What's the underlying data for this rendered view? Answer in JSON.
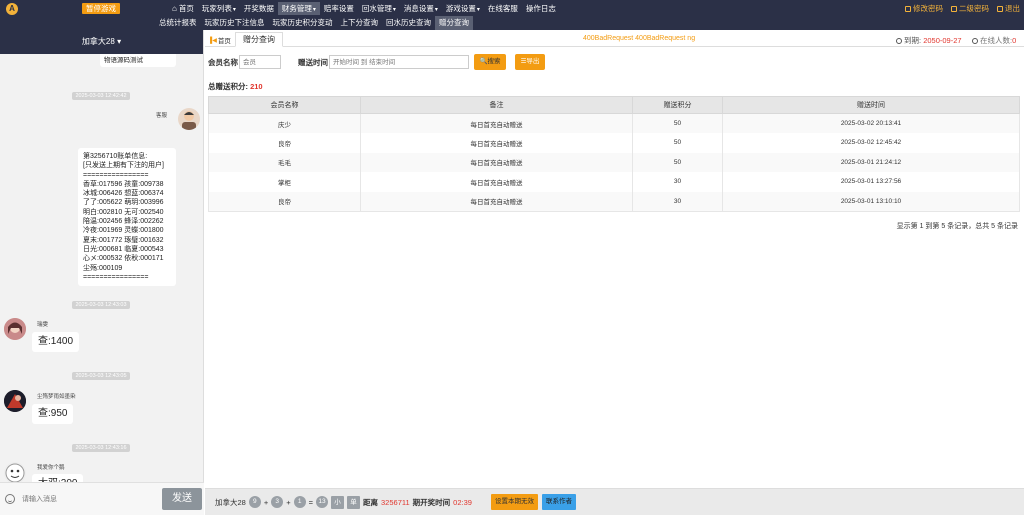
{
  "topbar": {
    "logo": "A",
    "pause_label": "暂停游戏",
    "nav_row1": [
      {
        "label": "首页",
        "home": true
      },
      {
        "label": "玩家列表",
        "dropdown": true
      },
      {
        "label": "开奖数据"
      },
      {
        "label": "财务管理",
        "dropdown": true,
        "active": true
      },
      {
        "label": "赔率设置"
      },
      {
        "label": "回水管理",
        "dropdown": true
      },
      {
        "label": "消息设置",
        "dropdown": true
      },
      {
        "label": "游戏设置",
        "dropdown": true
      },
      {
        "label": "在线客服"
      },
      {
        "label": "操作日志"
      }
    ],
    "nav_row2": [
      {
        "label": "总统计报表"
      },
      {
        "label": "玩家历史下注信息"
      },
      {
        "label": "玩家历史积分变动"
      },
      {
        "label": "上下分查询"
      },
      {
        "label": "回水历史查询"
      },
      {
        "label": "赠分查询",
        "active": true
      }
    ],
    "right_links": [
      "修改密码",
      "二级密码",
      "退出"
    ]
  },
  "chat": {
    "header": "加拿大28",
    "messages": [
      {
        "type": "partial",
        "text": "已开盘可以进行下注\n物语源码测试"
      },
      {
        "type": "time",
        "text": "2025-03-03 12:42:42"
      },
      {
        "type": "bill",
        "sender": "客服",
        "text": "第3256710账单信息:\n[只发送上期有下注的用户]\n================\n香草:017596 孩童:009738\n冰城:006426 想蓝:006374\n了了:005622 萌玥:003996\n明白:002810 无可:002540\n陪温:002456 蜂泽:002262\n冷夜:001969 灵蝶:001800\n夏末:001772 琢璧:001632\n日光:000681 临夏:000543\n心メ:000532 依秋:000171\n尘殇:000109\n================"
      },
      {
        "type": "time",
        "text": "2025-03-03 12:43:03"
      },
      {
        "type": "user",
        "sender": "瑞雯",
        "text": "查:1400"
      },
      {
        "type": "time",
        "text": "2025-03-03 12:43:05"
      },
      {
        "type": "user",
        "sender": "尘殇梦雨如墨染",
        "text": "查:950"
      },
      {
        "type": "time",
        "text": "2025-03-03 12:43:16"
      },
      {
        "type": "user",
        "sender": "我爱你个鹅",
        "text": "大双:200"
      }
    ],
    "input_placeholder": "请输入消息",
    "send_label": "发送"
  },
  "main": {
    "tab_home": "首页",
    "tab_active": "赠分查询",
    "ticker": "400BadRequest 400BadRequest ng",
    "expire_label": "到期:",
    "expire_value": "2050-09-27",
    "online_label": "在线人数:",
    "online_value": "0",
    "filter": {
      "member_label": "会员名称",
      "member_placeholder": "会员",
      "time_label": "赠送时间",
      "time_placeholder": "开始时间 到 结束时间",
      "search_label": "搜索",
      "export_label": "导出"
    },
    "total_label": "总赠送积分:",
    "total_value": "210",
    "table": {
      "headers": [
        "会员名称",
        "备注",
        "赠送积分",
        "赠送时间"
      ],
      "rows": [
        [
          "庆少",
          "每日首充自动赠送",
          "50",
          "2025-03-02 20:13:41"
        ],
        [
          "良帝",
          "每日首充自动赠送",
          "50",
          "2025-03-02 12:45:42"
        ],
        [
          "毛毛",
          "每日首充自动赠送",
          "50",
          "2025-03-01 21:24:12"
        ],
        [
          "掌柜",
          "每日首充自动赠送",
          "30",
          "2025-03-01 13:27:56"
        ],
        [
          "良帝",
          "每日首充自动赠送",
          "30",
          "2025-03-01 13:10:10"
        ]
      ]
    },
    "paging": "显示第 1 到第 5 条记录，总共 5 条记录"
  },
  "bottombar": {
    "game": "加拿大28",
    "balls": [
      "9",
      "3",
      "1"
    ],
    "plus": "+",
    "equals": "=",
    "sum": "13",
    "tags": [
      "小",
      "单"
    ],
    "distance_label": "距离",
    "issue": "3256711",
    "open_time_label": "期开奖时间",
    "countdown": "02:39",
    "set_button": "设置本期无效",
    "contact_button": "联系作者"
  }
}
